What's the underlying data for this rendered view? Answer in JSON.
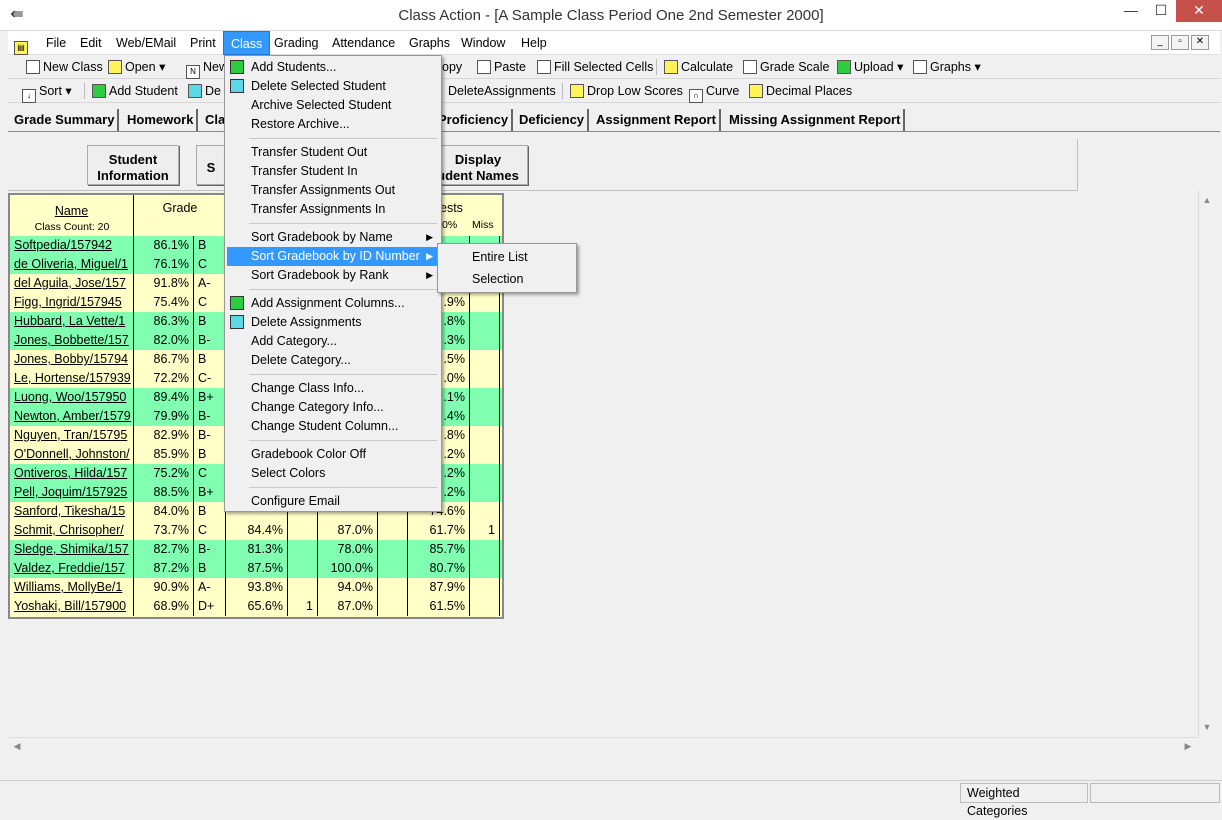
{
  "window": {
    "title": "Class Action - [A Sample Class Period One 2nd Semester 2000]",
    "minimize": "—",
    "maximize": "☐",
    "close": "✕"
  },
  "menubar": [
    "File",
    "Edit",
    "Web/EMail",
    "Print",
    "Class",
    "Grading",
    "Attendance",
    "Graphs",
    "Window",
    "Help"
  ],
  "mdi_controls": [
    "_",
    "▫",
    "✕"
  ],
  "toolbar1": {
    "new_class": "New Class",
    "open": "Open",
    "new": "New",
    "copy": "opy",
    "paste": "Paste",
    "fill": "Fill Selected Cells",
    "calculate": "Calculate",
    "grade_scale": "Grade Scale",
    "upload": "Upload",
    "graphs": "Graphs"
  },
  "toolbar2": {
    "sort": "Sort",
    "add_student": "Add Student",
    "de": "De",
    "delete_assignments": "DeleteAssignments",
    "drop_low": "Drop Low Scores",
    "curve": "Curve",
    "decimal": "Decimal Places"
  },
  "tabs": [
    "Grade Summary",
    "Homework",
    "Cla",
    "Proficiency",
    "Deficiency",
    "Assignment Report",
    "Missing Assignment Report"
  ],
  "buttons": {
    "student_info": "Student\nInformation",
    "s": "S",
    "display_names": "Display\nudent Names"
  },
  "grid": {
    "name_header": "Name",
    "class_count": "Class Count: 20",
    "grade_header": "Grade",
    "tests_header": "ests",
    "pct_header": "0%",
    "miss_header": "Miss",
    "rows": [
      {
        "name": "Softpedia/157942",
        "pct": "86.1%",
        "letter": "B",
        "c1": "",
        "c2": "",
        "c3": "",
        "c4": "",
        "t": "",
        "miss": "",
        "green": true
      },
      {
        "name": "de Oliveria, Miguel/1",
        "pct": "76.1%",
        "letter": "C",
        "c1": "",
        "c2": "",
        "c3": "",
        "c4": "",
        "t": "",
        "miss": "",
        "green": true
      },
      {
        "name": "del Aguila, Jose/157",
        "pct": "91.8%",
        "letter": "A-",
        "c1": "",
        "c2": "",
        "c3": "",
        "c4": "",
        "t": "",
        "miss": "",
        "green": false
      },
      {
        "name": "Figg, Ingrid/157945",
        "pct": "75.4%",
        "letter": "C",
        "c1": "",
        "c2": "",
        "c3": "",
        "c4": "",
        "t": ".9%",
        "miss": "",
        "green": false
      },
      {
        "name": "Hubbard, La Vette/1",
        "pct": "86.3%",
        "letter": "B",
        "c1": "",
        "c2": "",
        "c3": "",
        "c4": "",
        "t": ".8%",
        "miss": "",
        "green": true
      },
      {
        "name": "Jones, Bobbette/157",
        "pct": "82.0%",
        "letter": "B-",
        "c1": "",
        "c2": "",
        "c3": "",
        "c4": "",
        "t": ".3%",
        "miss": "",
        "green": true
      },
      {
        "name": "Jones, Bobby/15794",
        "pct": "86.7%",
        "letter": "B",
        "c1": "",
        "c2": "",
        "c3": "",
        "c4": "",
        "t": ".5%",
        "miss": "",
        "green": false
      },
      {
        "name": "Le, Hortense/157939",
        "pct": "72.2%",
        "letter": "C-",
        "c1": "",
        "c2": "",
        "c3": "",
        "c4": "",
        "t": ".0%",
        "miss": "",
        "green": false
      },
      {
        "name": "Luong, Woo/157950",
        "pct": "89.4%",
        "letter": "B+",
        "c1": "",
        "c2": "",
        "c3": "",
        "c4": "",
        "t": ".1%",
        "miss": "",
        "green": true
      },
      {
        "name": "Newton, Amber/1579",
        "pct": "79.9%",
        "letter": "B-",
        "c1": "",
        "c2": "",
        "c3": "",
        "c4": "",
        "t": ".4%",
        "miss": "",
        "green": true
      },
      {
        "name": "Nguyen, Tran/15795",
        "pct": "82.9%",
        "letter": "B-",
        "c1": "",
        "c2": "",
        "c3": "",
        "c4": "",
        "t": ".8%",
        "miss": "",
        "green": false
      },
      {
        "name": "O'Donnell, Johnston/",
        "pct": "85.9%",
        "letter": "B",
        "c1": "",
        "c2": "",
        "c3": "",
        "c4": "",
        "t": ".2%",
        "miss": "",
        "green": false
      },
      {
        "name": "Ontiveros, Hilda/157",
        "pct": "75.2%",
        "letter": "C",
        "c1": "",
        "c2": "",
        "c3": "",
        "c4": "",
        "t": ".2%",
        "miss": "",
        "green": true
      },
      {
        "name": "Pell, Joquim/157925",
        "pct": "88.5%",
        "letter": "B+",
        "c1": "",
        "c2": "",
        "c3": "",
        "c4": "",
        "t": ".2%",
        "miss": "",
        "green": true
      },
      {
        "name": "Sanford, Tikesha/15",
        "pct": "84.0%",
        "letter": "B",
        "c1": "",
        "c2": "",
        "c3": "",
        "c4": "",
        "t": "74.6%",
        "miss": "",
        "green": false
      },
      {
        "name": "Schmit, Chrisopher/",
        "pct": "73.7%",
        "letter": "C",
        "c1": "84.4%",
        "c2": "",
        "c3": "87.0%",
        "c4": "",
        "t": "61.7%",
        "miss": "1",
        "green": false
      },
      {
        "name": "Sledge, Shimika/157",
        "pct": "82.7%",
        "letter": "B-",
        "c1": "81.3%",
        "c2": "",
        "c3": "78.0%",
        "c4": "",
        "t": "85.7%",
        "miss": "",
        "green": true
      },
      {
        "name": "Valdez, Freddie/157",
        "pct": "87.2%",
        "letter": "B",
        "c1": "87.5%",
        "c2": "",
        "c3": "100.0%",
        "c4": "",
        "t": "80.7%",
        "miss": "",
        "green": true
      },
      {
        "name": "Williams, MollyBe/1",
        "pct": "90.9%",
        "letter": "A-",
        "c1": "93.8%",
        "c2": "",
        "c3": "94.0%",
        "c4": "",
        "t": "87.9%",
        "miss": "",
        "green": false
      },
      {
        "name": "Yoshaki, Bill/157900",
        "pct": "68.9%",
        "letter": "D+",
        "c1": "65.6%",
        "c2": "1",
        "c3": "87.0%",
        "c4": "",
        "t": "61.5%",
        "miss": "",
        "green": false
      }
    ]
  },
  "class_menu": [
    {
      "label": "Add Students...",
      "icon": "grn"
    },
    {
      "label": "Delete Selected Student",
      "icon": "cyn"
    },
    {
      "label": "Archive Selected Student"
    },
    {
      "label": "Restore Archive..."
    },
    {
      "sep": true
    },
    {
      "label": "Transfer Student Out"
    },
    {
      "label": "Transfer Student In"
    },
    {
      "label": "Transfer Assignments Out"
    },
    {
      "label": "Transfer Assignments In"
    },
    {
      "sep": true
    },
    {
      "label": "Sort Gradebook by Name",
      "sub": true
    },
    {
      "label": "Sort Gradebook by ID Number",
      "sub": true,
      "hl": true
    },
    {
      "label": "Sort Gradebook by Rank",
      "sub": true
    },
    {
      "sep": true
    },
    {
      "label": "Add Assignment Columns...",
      "icon": "grn"
    },
    {
      "label": "Delete Assignments",
      "icon": "cyn"
    },
    {
      "label": "Add Category..."
    },
    {
      "label": "Delete Category..."
    },
    {
      "sep": true
    },
    {
      "label": "Change Class Info..."
    },
    {
      "label": "Change Category Info..."
    },
    {
      "label": "Change Student Column..."
    },
    {
      "sep": true
    },
    {
      "label": "Gradebook Color Off"
    },
    {
      "label": "Select Colors"
    },
    {
      "sep": true
    },
    {
      "label": "Configure Email"
    }
  ],
  "sub_menu": [
    "Entire List",
    "Selection"
  ],
  "status": {
    "weighted": "Weighted Categories"
  },
  "colors": {
    "menu_highlight": "#3399ff",
    "row_green": "#80ffb0",
    "row_yellow": "#ffffc8"
  }
}
